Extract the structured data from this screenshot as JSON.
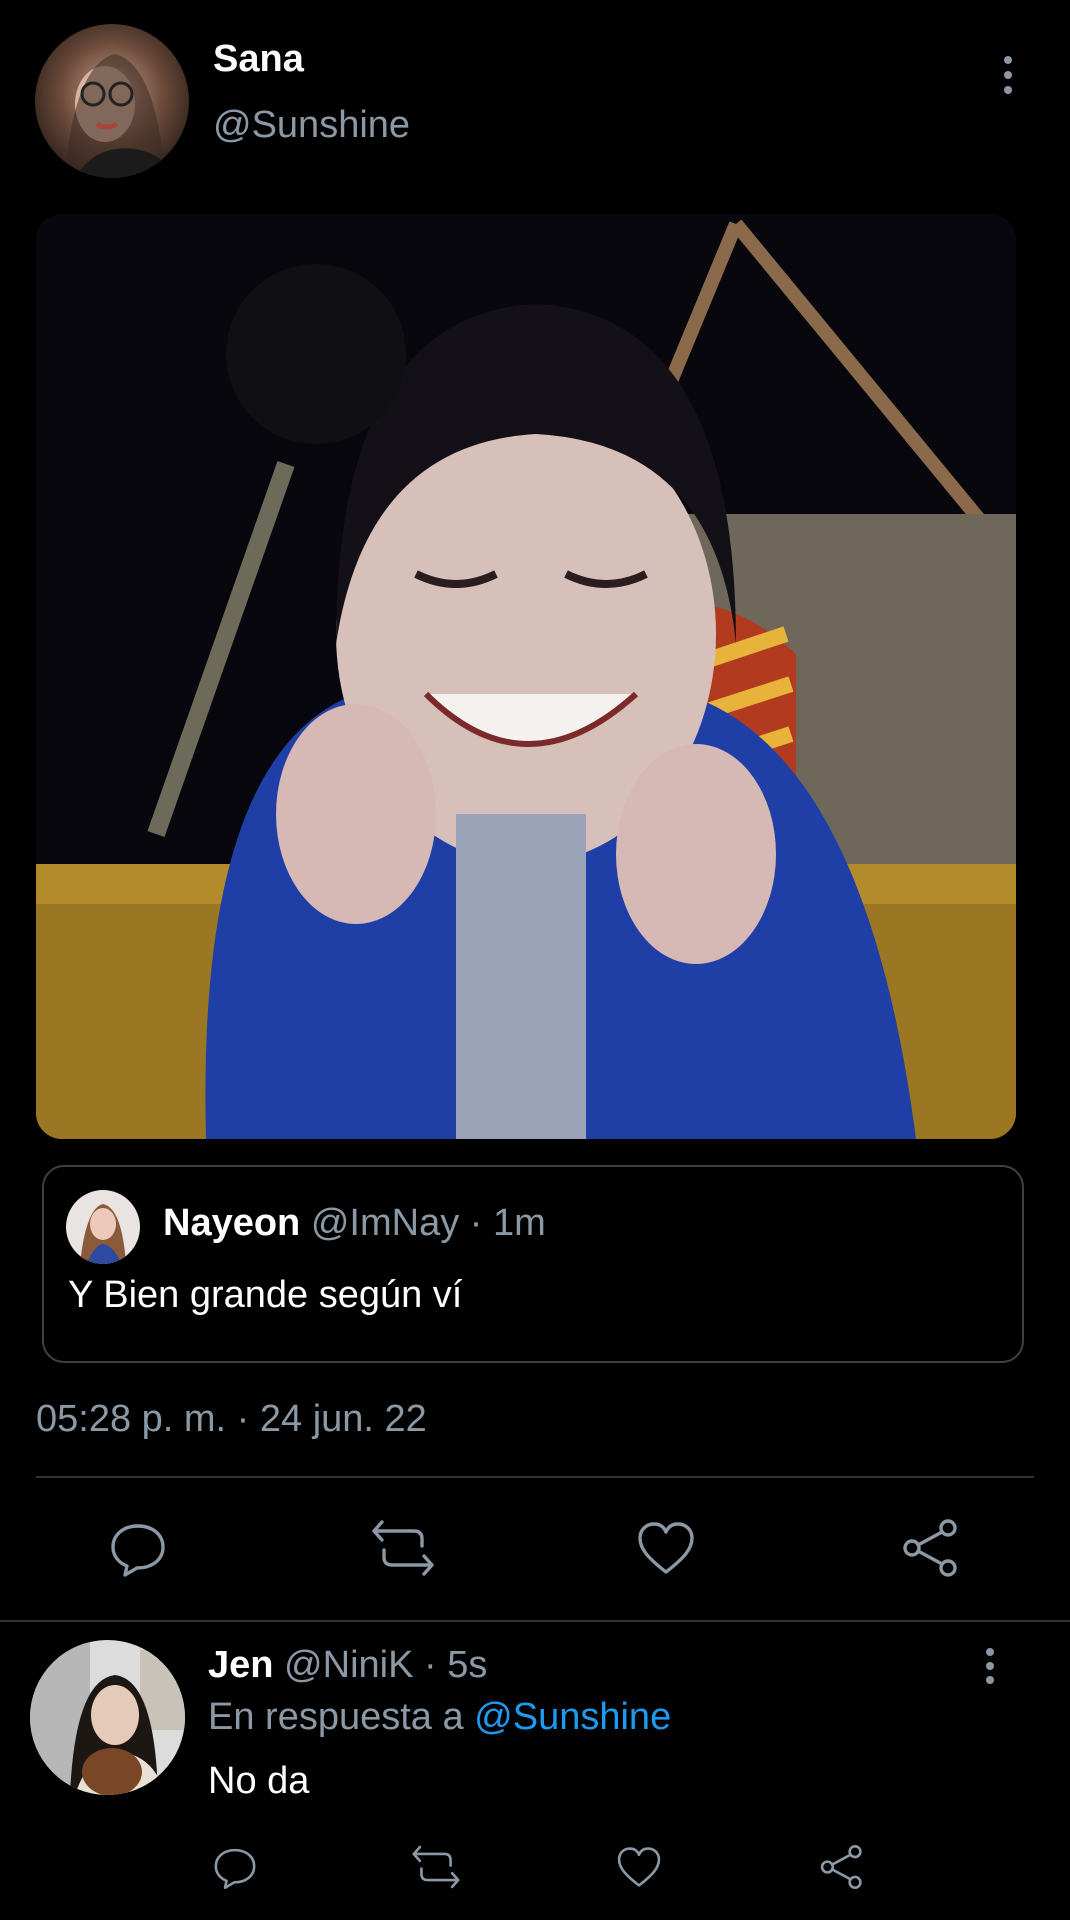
{
  "tweet": {
    "author_name": "Sana",
    "author_handle": "@Sunshine",
    "timestamp": "05:28 p. m. · 24 jun. 22"
  },
  "quoted": {
    "author_name": "Nayeon",
    "author_meta": "@ImNay · 1m",
    "text": "Y Bien grande según ví"
  },
  "actions": [
    "reply-icon",
    "retweet-icon",
    "like-icon",
    "share-icon"
  ],
  "reply": {
    "author_name": "Jen",
    "author_meta": "@NiniK · 5s",
    "reply_to_prefix": "En respuesta a",
    "reply_to_handle": "@Sunshine",
    "text": "No da"
  },
  "colors": {
    "background": "#000000",
    "muted": "#8b98a5",
    "link": "#1d9bf0",
    "divider": "#2f3336"
  }
}
